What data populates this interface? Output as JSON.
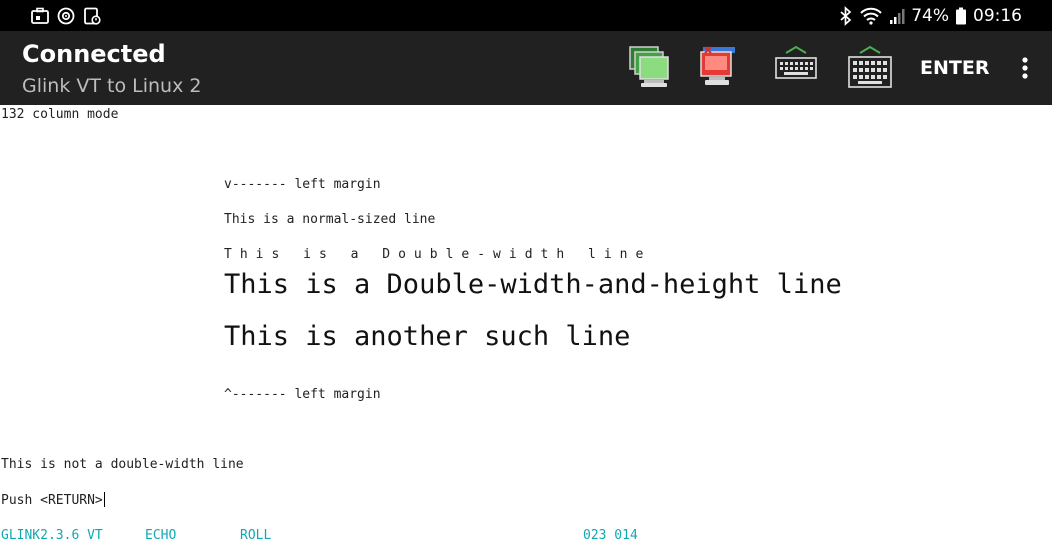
{
  "status_bar": {
    "battery_text": "74%",
    "time": "09:16"
  },
  "app_bar": {
    "title": "Connected",
    "subtitle": "Glink VT to Linux 2",
    "enter_label": "ENTER"
  },
  "terminal": {
    "lines": {
      "mode": "132 column mode",
      "margin_top": "v------- left margin",
      "normal": "This is a normal-sized line",
      "double_width": "This is a Double-width line",
      "double_height_1": "This is a Double-width-and-height line",
      "double_height_2": "This is another such line",
      "margin_bottom": "^------- left margin",
      "not_double": "This is not a double-width line",
      "prompt": "Push <RETURN>"
    },
    "status": {
      "version": "GLINK2.3.6 VT",
      "echo": "ECHO",
      "roll": "ROLL",
      "cursor_pos": "023 014"
    }
  },
  "colors": {
    "status_bar_bg": "#000000",
    "app_bar_bg": "#212121",
    "terminal_bg": "#ffffff",
    "status_line_text": "#10a9b3"
  }
}
